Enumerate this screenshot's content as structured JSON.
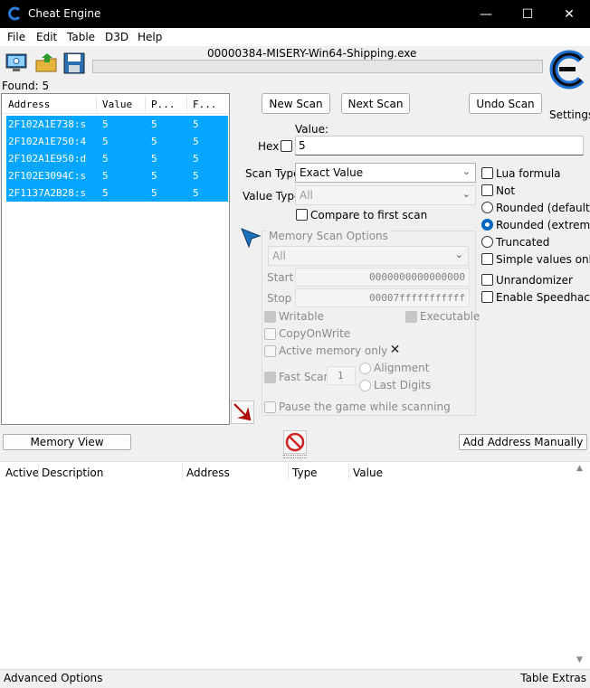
{
  "window": {
    "title": "Cheat Engine",
    "minimize": "—",
    "maximize": "☐",
    "close": "✕"
  },
  "menu": [
    "File",
    "Edit",
    "Table",
    "D3D",
    "Help"
  ],
  "process_name": "00000384-MISERY-Win64-Shipping.exe",
  "found_label": "Found: 5",
  "found_list": {
    "columns": [
      "Address",
      "Value",
      "P...",
      "F..."
    ],
    "rows": [
      [
        "2F102A1E738:s",
        "5",
        "5",
        "5"
      ],
      [
        "2F102A1E750:4",
        "5",
        "5",
        "5"
      ],
      [
        "2F102A1E950:d",
        "5",
        "5",
        "5"
      ],
      [
        "2F102E3094C:s",
        "5",
        "5",
        "5"
      ],
      [
        "2F1137A2B28:s",
        "5",
        "5",
        "5"
      ]
    ]
  },
  "buttons": {
    "new_scan": "New Scan",
    "next_scan": "Next Scan",
    "undo_scan": "Undo Scan",
    "memory_view": "Memory View",
    "add_address": "Add Address Manually"
  },
  "settings_label": "Settings",
  "value_label": "Value:",
  "hex_label": "Hex",
  "value_input": "5",
  "scan_type_label": "Scan Type",
  "scan_type_value": "Exact Value",
  "value_type_label": "Value Type",
  "value_type_value": "All",
  "compare_first": "Compare to first scan",
  "right_options": {
    "lua_formula": "Lua formula",
    "not": "Not",
    "rounded_default": "Rounded (default)",
    "rounded_extreme": "Rounded (extreme)",
    "truncated": "Truncated",
    "simple_values": "Simple values only",
    "unrandomizer": "Unrandomizer",
    "speedhack": "Enable Speedhack"
  },
  "memory_scan": {
    "title": "Memory Scan Options",
    "region": "All",
    "start_label": "Start",
    "start_value": "0000000000000000",
    "stop_label": "Stop",
    "stop_value": "00007fffffffffff",
    "writable": "Writable",
    "executable": "Executable",
    "copy_on_write": "CopyOnWrite",
    "active_memory": "Active memory only",
    "fast_scan": "Fast Scan",
    "fast_scan_value": "1",
    "alignment": "Alignment",
    "last_digits": "Last Digits",
    "pause_game": "Pause the game while scanning"
  },
  "address_list": {
    "columns": [
      "Active",
      "Description",
      "Address",
      "Type",
      "Value"
    ]
  },
  "status": {
    "left": "Advanced Options",
    "right": "Table Extras"
  },
  "colors": {
    "selection": "#05a6ff",
    "titlebar": "#000000",
    "accent": "#0067c0"
  }
}
